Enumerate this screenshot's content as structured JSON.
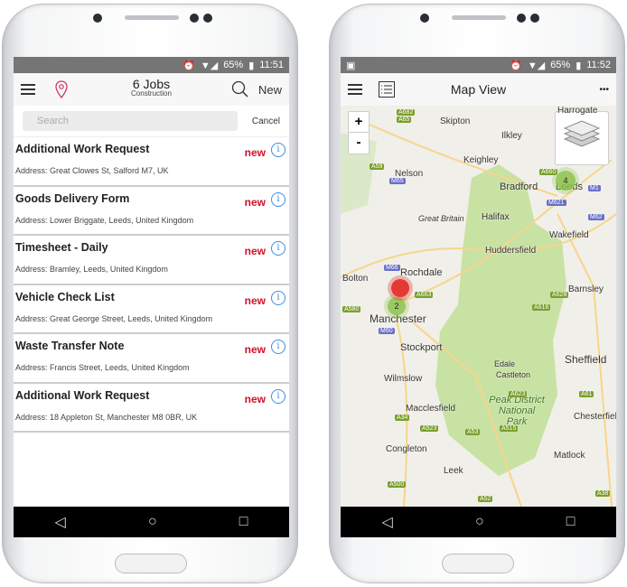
{
  "left_phone": {
    "status": {
      "battery": "65%",
      "time": "11:51"
    },
    "header": {
      "title": "6 Jobs",
      "subtitle": "Construction",
      "new_label": "New"
    },
    "search": {
      "placeholder": "Search",
      "cancel_label": "Cancel"
    },
    "jobs": [
      {
        "title": "Additional Work Request",
        "address": "Address: Great Clowes St, Salford M7, UK",
        "badge": "new"
      },
      {
        "title": "Goods Delivery Form",
        "address": "Address: Lower Briggate, Leeds, United Kingdom",
        "badge": "new"
      },
      {
        "title": "Timesheet - Daily",
        "address": "Address: Bramley, Leeds, United Kingdom",
        "badge": "new"
      },
      {
        "title": "Vehicle Check List",
        "address": "Address: Great George Street, Leeds, United Kingdom",
        "badge": "new"
      },
      {
        "title": "Waste Transfer Note",
        "address": "Address: Francis Street, Leeds, United Kingdom",
        "badge": "new"
      },
      {
        "title": "Additional Work Request",
        "address": "Address: 18 Appleton St, Manchester M8 0BR, UK",
        "badge": "new"
      }
    ]
  },
  "right_phone": {
    "status": {
      "battery": "65%",
      "time": "11:52"
    },
    "header": {
      "title": "Map View",
      "more_label": "•••"
    },
    "zoom": {
      "in": "+",
      "out": "-"
    },
    "clusters": [
      {
        "count": "4",
        "color": "#8bc34a"
      },
      {
        "count": "2",
        "color": "#8bc34a"
      },
      {
        "count": "",
        "color": "#e53935"
      }
    ],
    "places": [
      "Harrogate",
      "Skipton",
      "Ilkley",
      "Keighley",
      "Nelson",
      "Bradford",
      "Leeds",
      "Great Britain",
      "Halifax",
      "Huddersfield",
      "Wakefield",
      "Rochdale",
      "Bolton",
      "Manchester",
      "Barnsley",
      "Stockport",
      "Sheffield",
      "Edale",
      "Castleton",
      "Wilmslow",
      "Macclesfield",
      "Peak District National Park",
      "Chesterfield",
      "Congleton",
      "Matlock",
      "Leek"
    ],
    "roads": [
      "A682",
      "A65",
      "A59",
      "A660",
      "M65",
      "M621",
      "M1",
      "M62",
      "M66",
      "A663",
      "A628",
      "A580",
      "A616",
      "M60",
      "A623",
      "A61",
      "A34",
      "A523",
      "A53",
      "A515",
      "A500",
      "A52",
      "A38"
    ]
  },
  "colors": {
    "accent": "#d0112b",
    "info": "#3b8ee0",
    "park": "#c5e0a0",
    "map_bg": "#f1efe9"
  }
}
